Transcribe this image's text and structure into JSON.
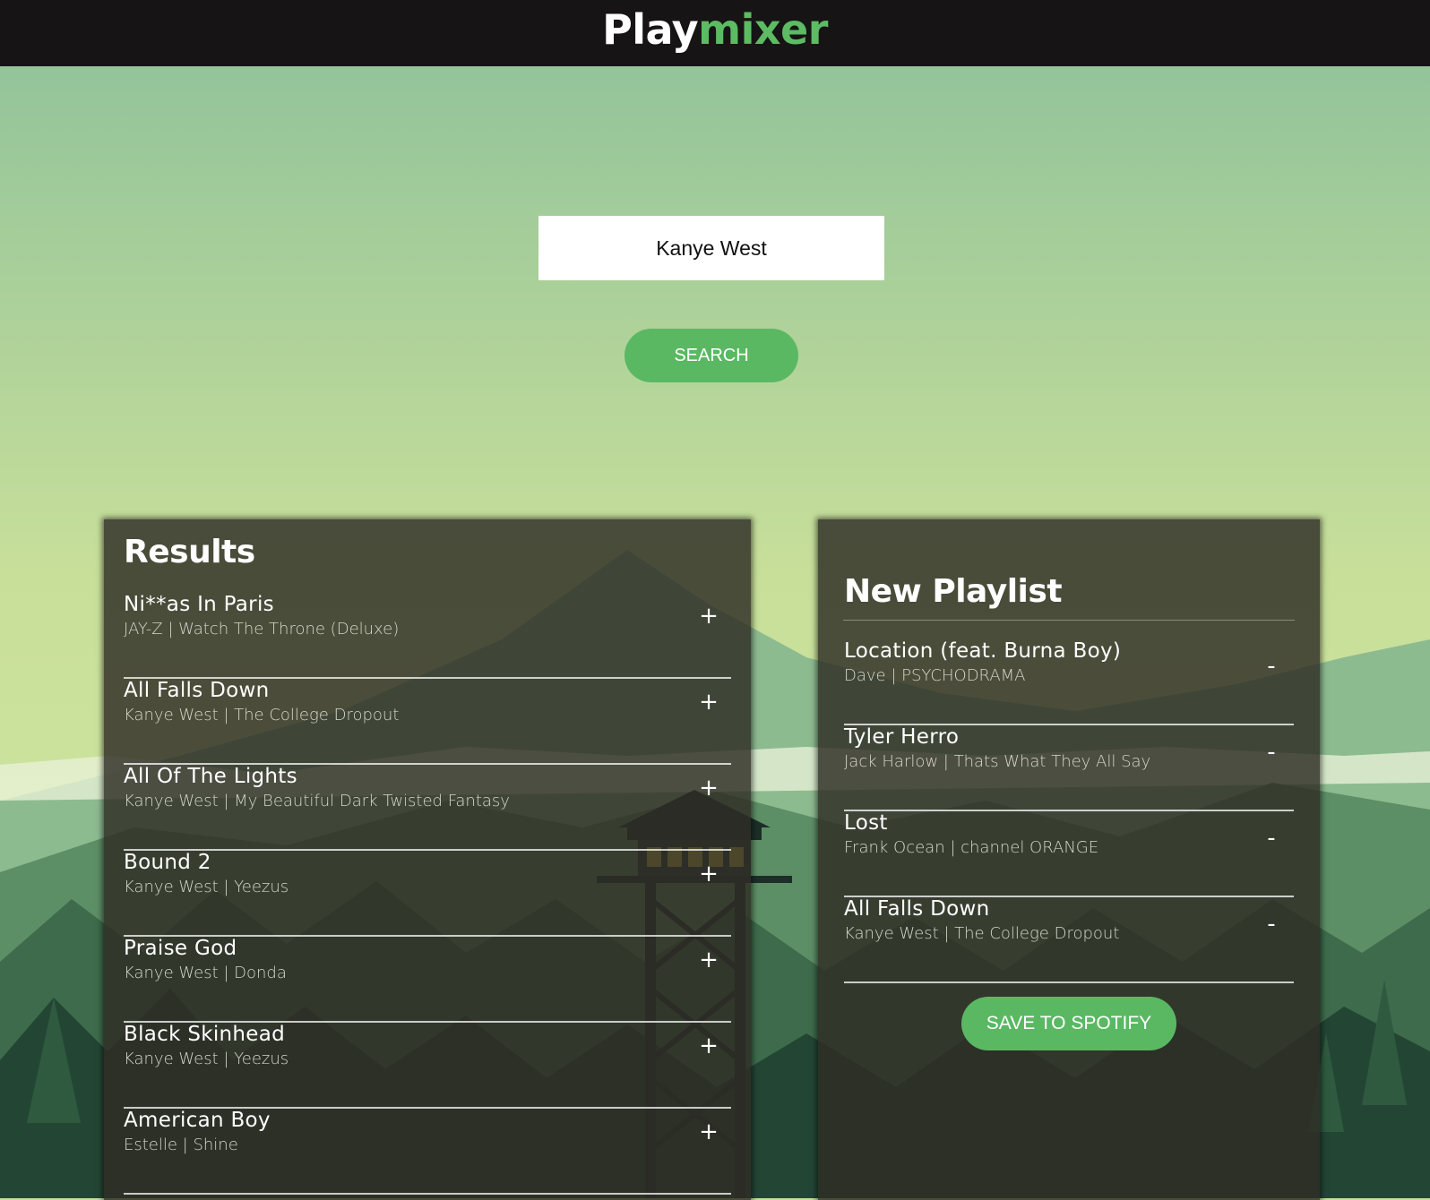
{
  "app": {
    "logo_main": "Play",
    "logo_accent": "mixer"
  },
  "search": {
    "value": "Kanye West",
    "button_label": "SEARCH"
  },
  "results": {
    "title": "Results",
    "add_symbol": "+",
    "tracks": [
      {
        "name": "Ni**as In Paris",
        "info": "JAY-Z | Watch The Throne (Deluxe)"
      },
      {
        "name": "All Falls Down",
        "info": "Kanye West | The College Dropout"
      },
      {
        "name": "All Of The Lights",
        "info": "Kanye West | My Beautiful Dark Twisted Fantasy"
      },
      {
        "name": "Bound 2",
        "info": "Kanye West | Yeezus"
      },
      {
        "name": "Praise God",
        "info": "Kanye West | Donda"
      },
      {
        "name": "Black Skinhead",
        "info": "Kanye West | Yeezus"
      },
      {
        "name": "American Boy",
        "info": "Estelle | Shine"
      }
    ]
  },
  "playlist": {
    "title": "New Playlist",
    "remove_symbol": "-",
    "save_label": "SAVE TO SPOTIFY",
    "tracks": [
      {
        "name": "Location (feat. Burna Boy)",
        "info": "Dave | PSYCHODRAMA"
      },
      {
        "name": "Tyler Herro",
        "info": "Jack Harlow | Thats What They All Say"
      },
      {
        "name": "Lost",
        "info": "Frank Ocean | channel ORANGE"
      },
      {
        "name": "All Falls Down",
        "info": "Kanye West | The College Dropout"
      }
    ]
  },
  "colors": {
    "header_bg": "#161414",
    "accent": "#5cbb63",
    "sky_top": "#93c49a",
    "sky_bottom": "#cbe29c",
    "panel_bg": "#2e2c24"
  }
}
